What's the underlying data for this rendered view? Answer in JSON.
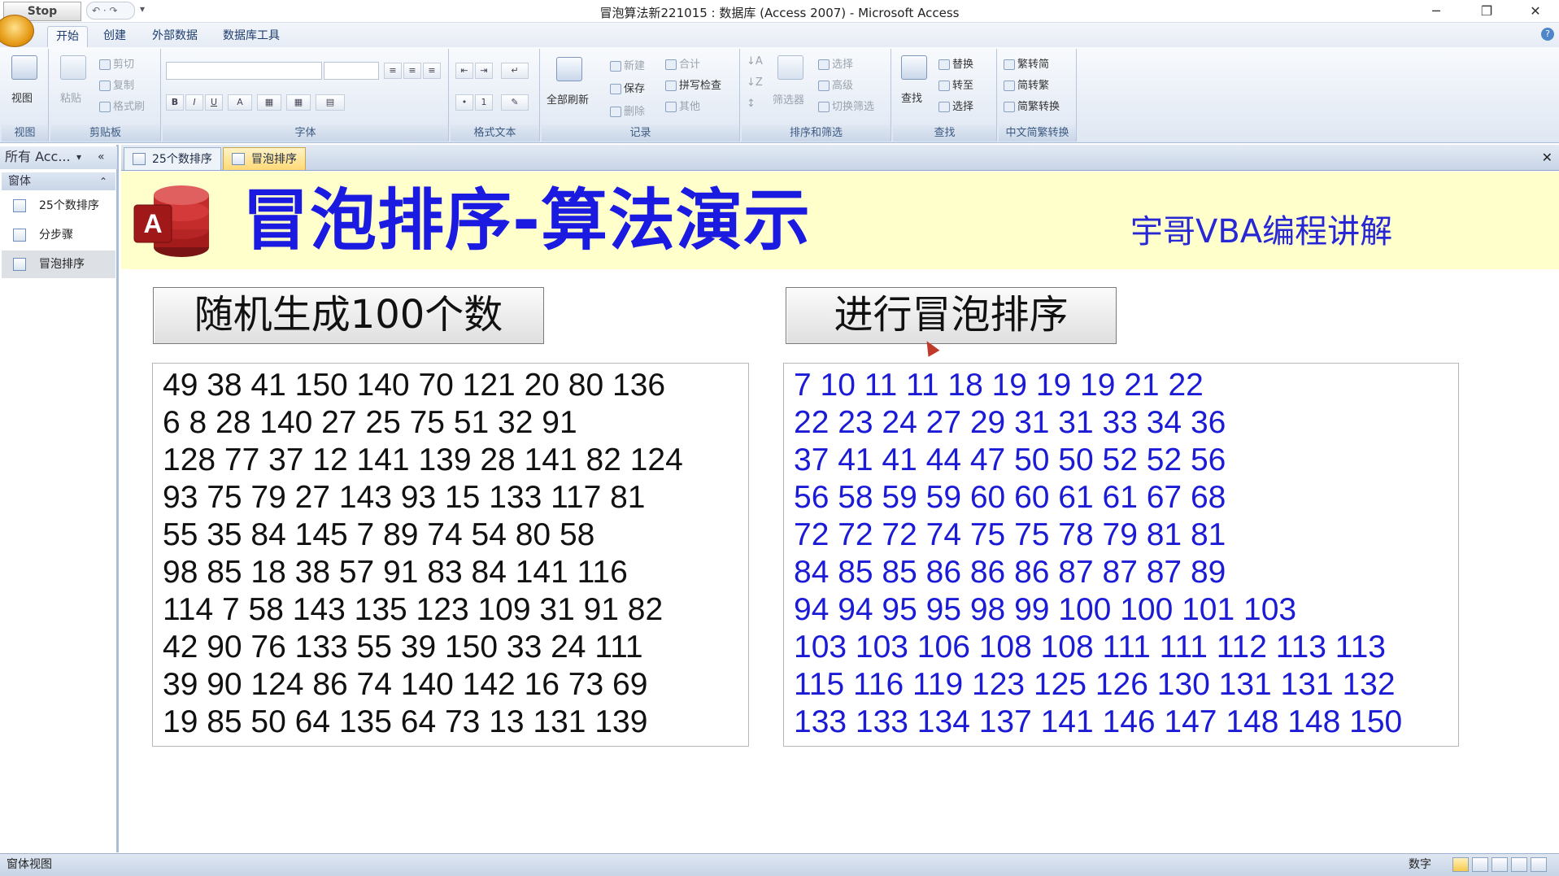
{
  "titlebar": {
    "stop_label": "Stop",
    "window_title": "冒泡算法新221015 : 数据库 (Access 2007) - Microsoft Access",
    "minimize": "─",
    "restore": "❐",
    "close": "✕"
  },
  "ribbon_tabs": [
    "开始",
    "创建",
    "外部数据",
    "数据库工具"
  ],
  "ribbon": {
    "view": {
      "big": "视图",
      "label": "视图"
    },
    "clipboard": {
      "paste": "粘贴",
      "cut": "剪切",
      "copy": "复制",
      "format_painter": "格式刷",
      "label": "剪贴板"
    },
    "font": {
      "label": "字体",
      "bold": "B",
      "italic": "I",
      "underline": "U",
      "color": "A"
    },
    "rich_text": {
      "label": "格式文本"
    },
    "records": {
      "refresh": "全部刷新",
      "new": "新建",
      "save": "保存",
      "delete": "删除",
      "totals": "合计",
      "spelling": "拼写检查",
      "more": "其他",
      "label": "记录"
    },
    "sort_filter": {
      "filter": "筛选器",
      "selection": "选择",
      "advanced": "高级",
      "toggle": "切换筛选",
      "label": "排序和筛选"
    },
    "find": {
      "find": "查找",
      "replace": "替换",
      "goto": "转至",
      "select": "选择",
      "label": "查找"
    },
    "chinese": {
      "t2s": "繁转简",
      "s2t": "简转繁",
      "convert": "简繁转换",
      "label": "中文简繁转换"
    }
  },
  "nav": {
    "header": "所有 Acc...",
    "group": "窗体",
    "items": [
      {
        "label": "25个数排序",
        "selected": false
      },
      {
        "label": "分步骤",
        "selected": false
      },
      {
        "label": "冒泡排序",
        "selected": true
      }
    ]
  },
  "doc_tabs": [
    {
      "label": "25个数排序",
      "active": false
    },
    {
      "label": "冒泡排序",
      "active": true
    }
  ],
  "form": {
    "logo_letter": "A",
    "title": "冒泡排序-算法演示",
    "subtitle": "宇哥VBA编程讲解",
    "generate_button": "随机生成100个数",
    "sort_button": "进行冒泡排序",
    "unsorted_lines": [
      "49 38 41 150 140 70 121 20 80 136",
      "6 8 28 140 27 25 75 51 32 91",
      "128 77 37 12 141 139 28 141 82 124",
      "93 75 79 27 143 93 15 133 117 81",
      "55 35 84 145 7 89 74 54 80 58",
      "98 85 18 38 57 91 83 84 141 116",
      "114 7 58 143 135 123 109 31 91 82",
      "42 90 76 133 55 39 150 33 24 111",
      "39 90 124 86 74 140 142 16 73 69",
      "19 85 50 64 135 64 73 13 131 139"
    ],
    "sorted_lines": [
      "7 10 11 11 18 19 19 19 21 22",
      "22 23 24 27 29 31 31 33 34 36",
      "37 41 41 44 47 50 50 52 52 56",
      "56 58 59 59 60 60 61 61 67 68",
      "72 72 72 74 75 75 78 79 81 81",
      "84 85 85 86 86 86 87 87 87 89",
      "94 94 95 95 98 99 100 100 101 103",
      "103 103 106 108 108 111 111 112 113 113",
      "115 116 119 123 125 126 130 131 131 132",
      "133 133 134 137 141 146 147 148 148 150"
    ]
  },
  "status": {
    "left": "窗体视图",
    "right": "数字"
  }
}
